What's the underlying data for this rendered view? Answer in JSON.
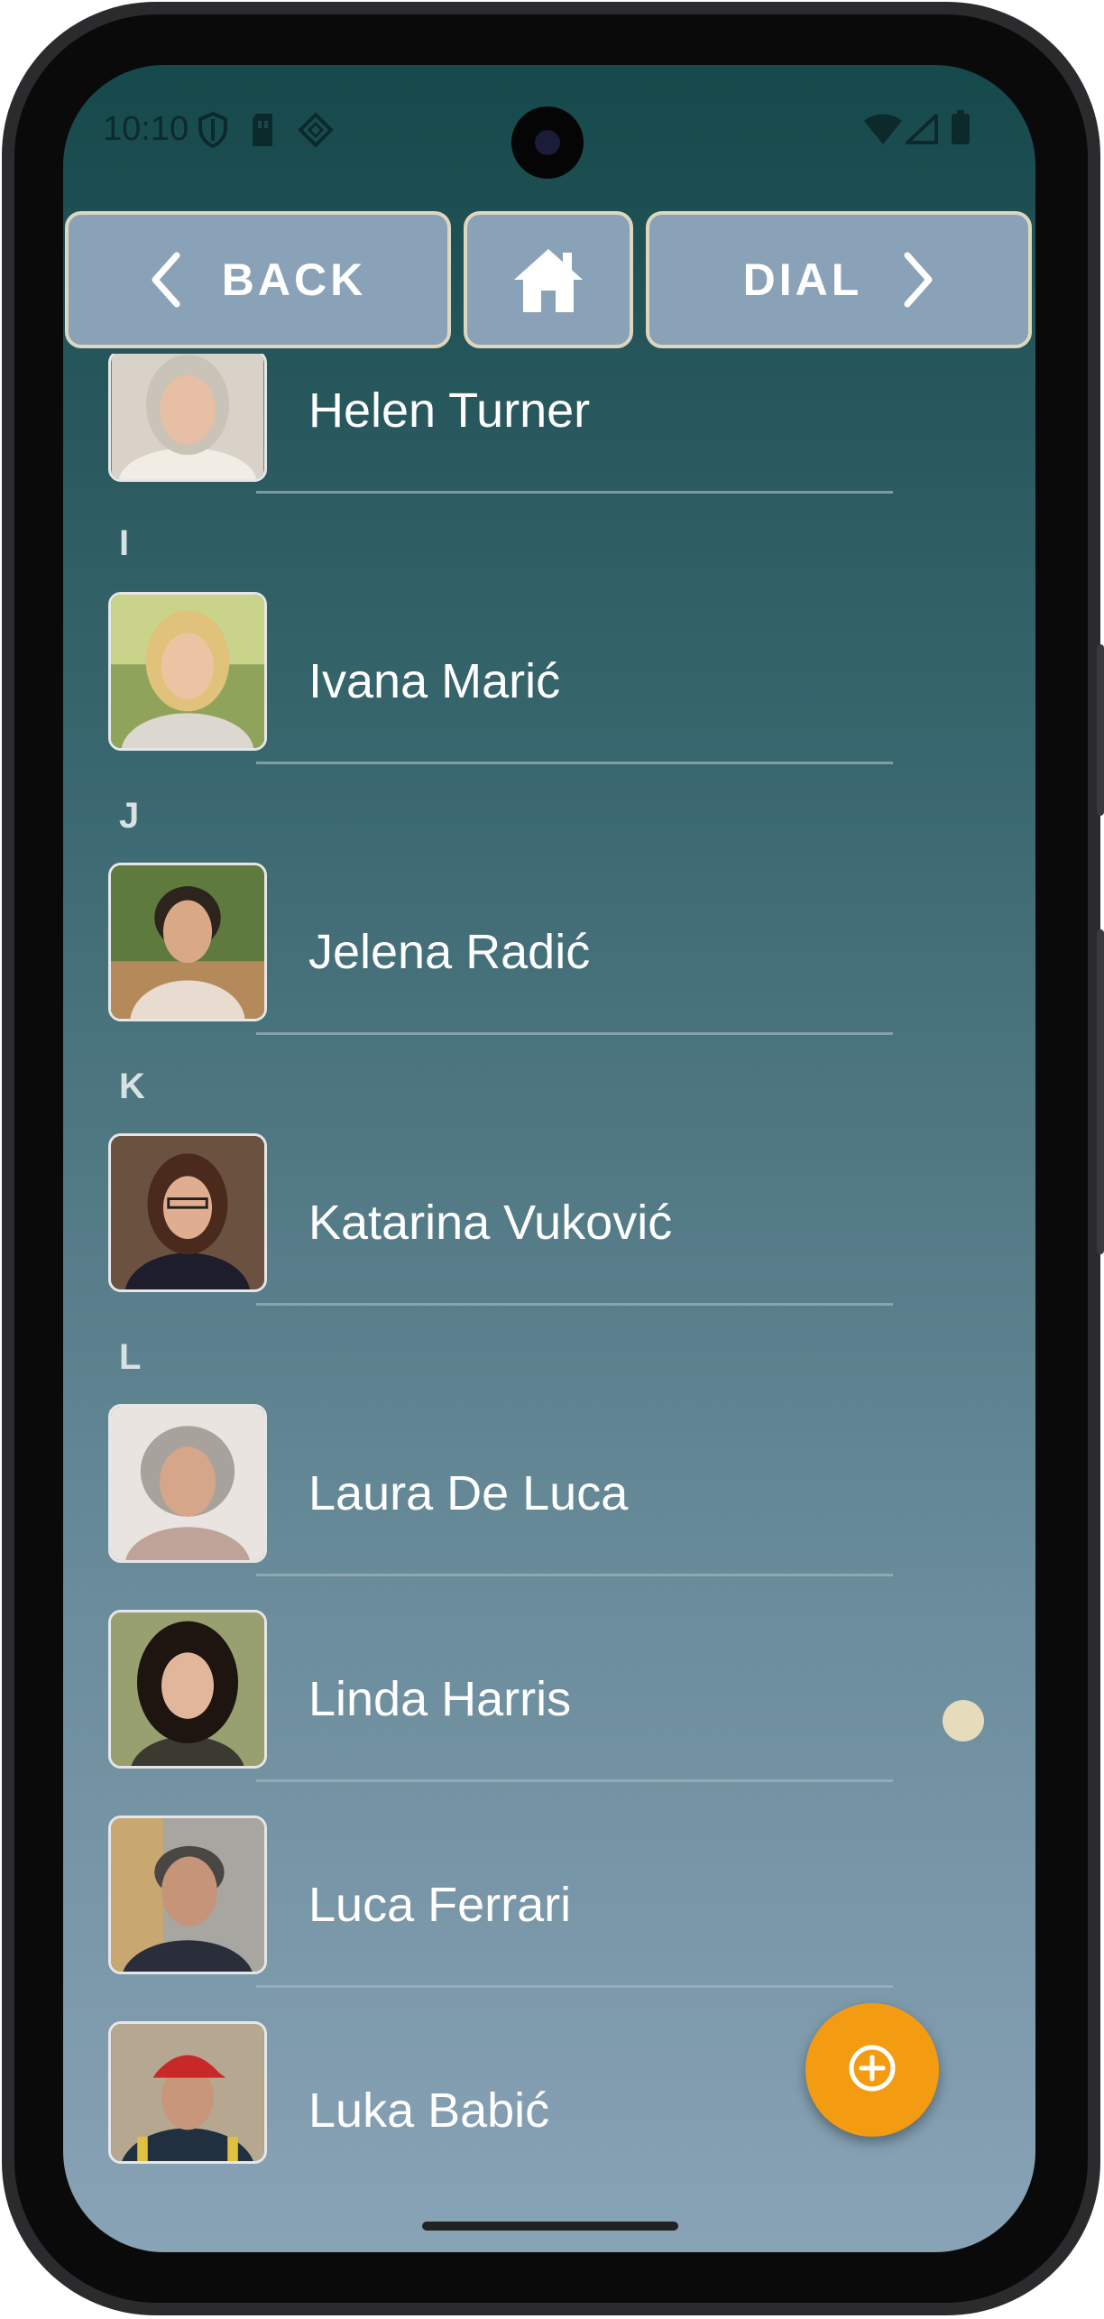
{
  "status_bar": {
    "time": "10:10",
    "left_icons": [
      "shield-icon",
      "sim-card-icon",
      "nfc-icon"
    ],
    "right_icons": [
      "wifi-icon",
      "signal-icon",
      "battery-icon"
    ]
  },
  "nav": {
    "back_label": "BACK",
    "home_icon": "home-icon",
    "dial_label": "DIAL"
  },
  "colors": {
    "nav_button_bg": "#8aa2b7",
    "nav_button_border": "#ddd7bf",
    "fab": "#f39c12",
    "scroll_dot": "#e6dcbc"
  },
  "contacts": [
    {
      "name": "Helen Turner"
    },
    {
      "section": "I"
    },
    {
      "name": "Ivana Marić"
    },
    {
      "section": "J"
    },
    {
      "name": "Jelena Radić"
    },
    {
      "section": "K"
    },
    {
      "name": "Katarina Vuković"
    },
    {
      "section": "L"
    },
    {
      "name": "Laura De Luca"
    },
    {
      "name": "Linda Harris"
    },
    {
      "name": "Luca Ferrari"
    },
    {
      "name": "Luka Babić"
    }
  ],
  "fab_icon": "add-circle-icon"
}
